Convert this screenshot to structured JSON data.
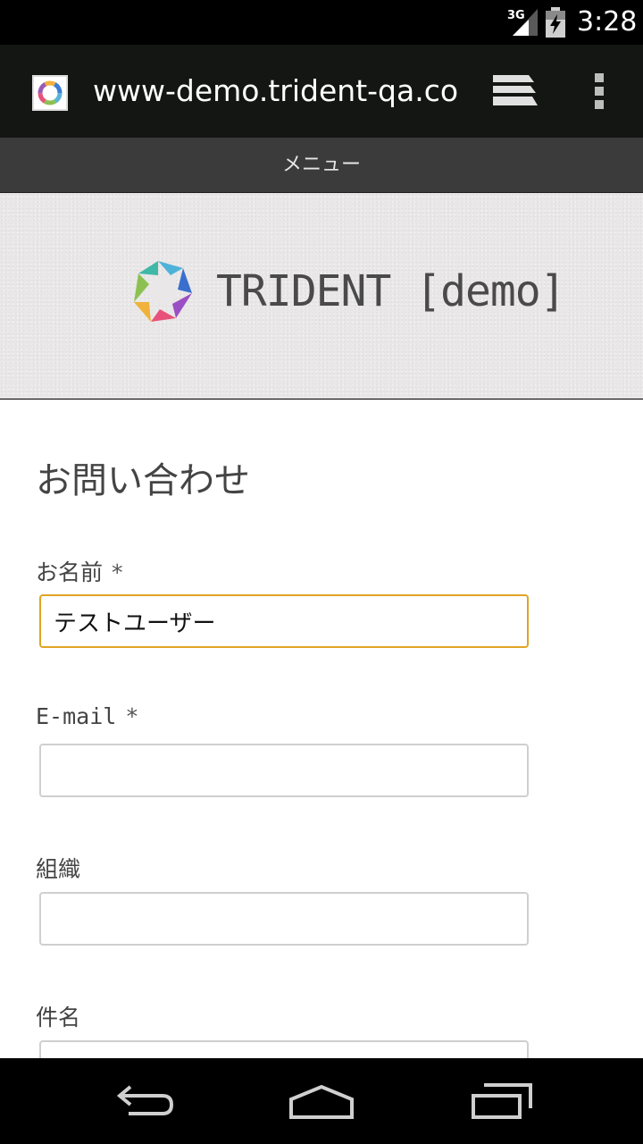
{
  "status_bar": {
    "network": "3G",
    "time": "3:28"
  },
  "browser": {
    "url": "www-demo.trident-qa.com"
  },
  "menu_bar": {
    "label": "メニュー"
  },
  "banner": {
    "site_name": "TRIDENT [demo]"
  },
  "form": {
    "title": "お問い合わせ",
    "required_mark": "*",
    "fields": [
      {
        "label": "お名前",
        "required": true,
        "value": "テストユーザー"
      },
      {
        "label": "E-mail",
        "required": true,
        "value": ""
      },
      {
        "label": "組織",
        "required": false,
        "value": ""
      },
      {
        "label": "件名",
        "required": false,
        "value": ""
      }
    ]
  },
  "colors": {
    "focused_border": "#e0a424",
    "toolbar_bg": "#141614",
    "menu_bar_bg": "#3a3b3a"
  }
}
